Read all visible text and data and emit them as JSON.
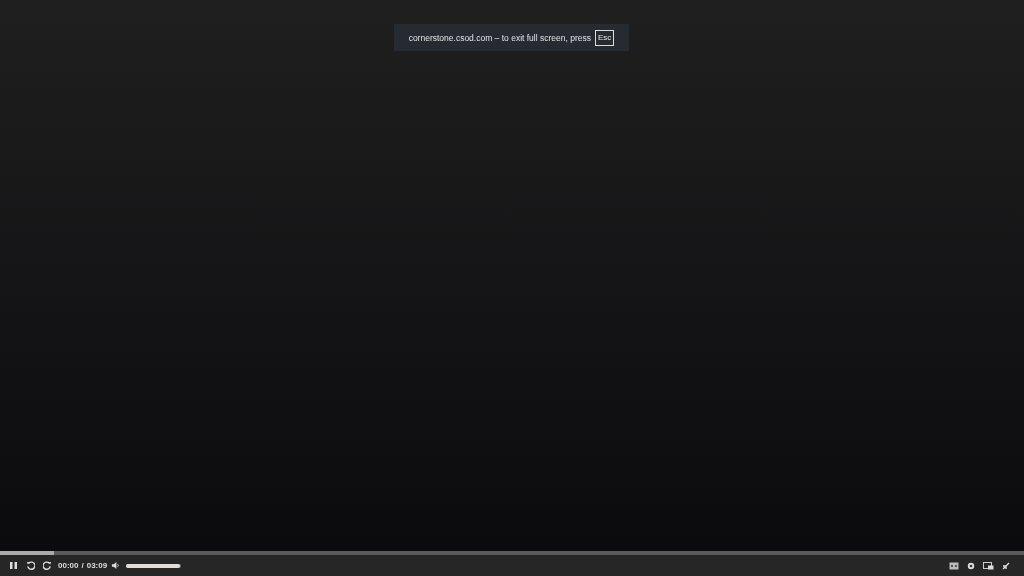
{
  "fullscreen_notice": {
    "text": "cornerstone.csod.com – to exit full screen, press",
    "key": "Esc"
  },
  "player": {
    "progress": {
      "level": 0.053
    },
    "current_time": "00:00",
    "separator": "/",
    "duration": "03:09",
    "volume": {
      "level": 0.97
    },
    "playing": true
  }
}
